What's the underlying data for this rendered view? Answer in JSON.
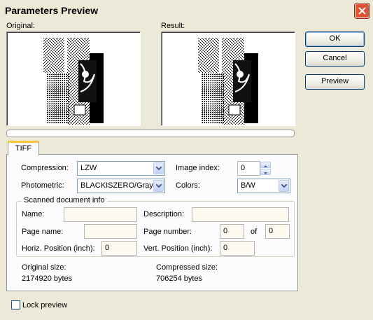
{
  "window": {
    "title": "Parameters Preview"
  },
  "previews": {
    "original_label": "Original:",
    "result_label": "Result:"
  },
  "buttons": {
    "ok": "OK",
    "cancel": "Cancel",
    "preview": "Preview"
  },
  "tabs": [
    {
      "label": "TIFF",
      "selected": true
    }
  ],
  "tiff": {
    "compression_label": "Compression:",
    "compression_value": "LZW",
    "photometric_label": "Photometric:",
    "photometric_value": "BLACKISZERO/Gray",
    "image_index_label": "Image index:",
    "image_index_value": "0",
    "colors_label": "Colors:",
    "colors_value": "B/W"
  },
  "scanned_info": {
    "group_label": "Scanned document info",
    "name_label": "Name:",
    "name_value": "",
    "description_label": "Description:",
    "description_value": "",
    "page_name_label": "Page name:",
    "page_name_value": "",
    "page_number_label": "Page number:",
    "page_number_value": "0",
    "of_label": "of",
    "page_total_value": "0",
    "horiz_label": "Horiz. Position (inch):",
    "horiz_value": "0",
    "vert_label": "Vert. Position (inch):",
    "vert_value": "0"
  },
  "sizes": {
    "original_label": "Original size:",
    "original_value": "2174920 bytes",
    "compressed_label": "Compressed size:",
    "compressed_value": "706254 bytes"
  },
  "lock_preview": {
    "label": "Lock preview",
    "checked": false
  },
  "progress": {
    "value": 0
  }
}
